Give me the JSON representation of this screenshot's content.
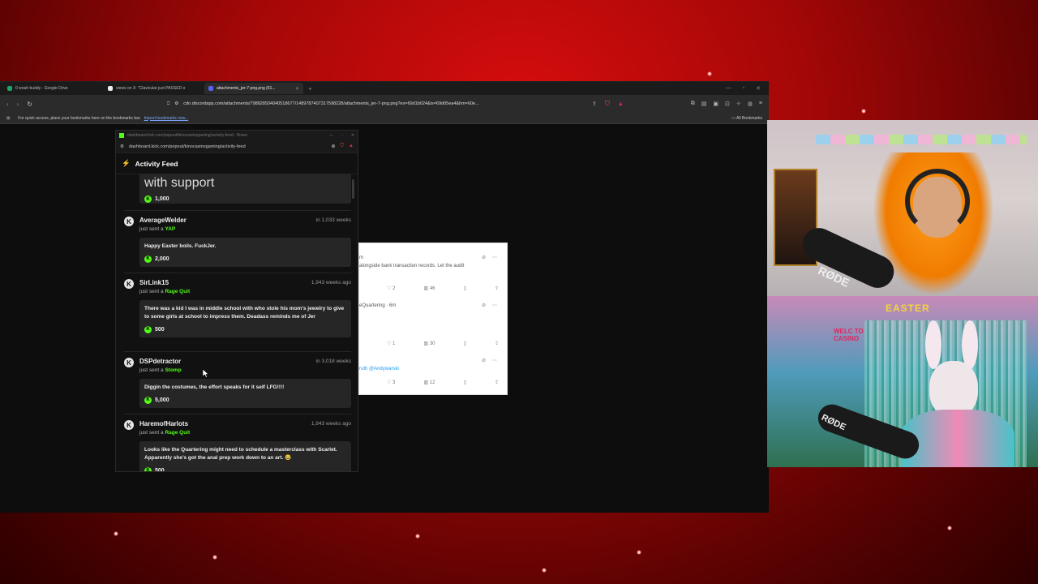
{
  "browser": {
    "tabs": [
      {
        "label": "0 woah buddy - Google Drive",
        "color": "#1fa463"
      },
      {
        "label": "views on X: \"Clavicular just PASSED o",
        "color": "#eeeeee"
      },
      {
        "label": "attachments_jer-7-png.png (61...",
        "color": "#5865f2"
      }
    ],
    "url": "cdn.discordapp.com/attachments/798828934040518677/1489787407317598228/attachments_jer-7-png.png?ex=69d1b024&is=69d05ea4&hm=60e...",
    "bookmarks_prompt": "For quick access, place your bookmarks here on the bookmarks bar.",
    "import_link": "Import bookmarks now...",
    "all_bookmarks": "All Bookmarks"
  },
  "popout": {
    "title_url": "dashboard.kick.com/popout/kinocasinogaming/activity-feed - Brave",
    "url": "dashboard.kick.com/popout/kinocasinogaming/activity-feed",
    "header": "Activity Feed",
    "top_entry": {
      "message": "with support",
      "amount": "1,000"
    },
    "entries": [
      {
        "user": "AverageWelder",
        "time": "in 1,033 weeks",
        "action": "just sent a",
        "item": "YAP",
        "message": "Happy Easter boils. FuckJer.",
        "amount": "2,000"
      },
      {
        "user": "SirLink15",
        "time": "1,943 weeks ago",
        "action": "just sent a",
        "item": "Rage Quit",
        "message": "There was a kid I was in middle school with who stole his mom's jewelry to give to some girls at school to impress them. Deadass reminds me of Jer",
        "amount": "500"
      },
      {
        "user": "DSPdetractor",
        "time": "in 3,018 weeks",
        "action": "just sent a",
        "item": "Stomp",
        "message": "Diggin the costumes, the effort speaks for it self LFG!!!!",
        "amount": "5,000"
      },
      {
        "user": "HaremofHarlots",
        "time": "1,943 weeks ago",
        "action": "just sent a",
        "item": "Rage Quit",
        "message": "Looks like the Quartering might need to schedule a masterclass with Scarlet. Apparently she's got the anal prep work down to an art. 😂",
        "amount": "500"
      }
    ]
  },
  "tweet": {
    "line1_prefix": "m",
    "line2": "alongside bank transaction records. Let the audit",
    "row1": {
      "likes": "2",
      "views": "46"
    },
    "line3": "eQuartering · 6m",
    "row2": {
      "likes": "1",
      "views": "30"
    },
    "line4": "ruth @Andywarski",
    "row3": {
      "likes": "3",
      "views": "12"
    }
  },
  "overlay": {
    "banner": "EASTER",
    "mic1": "RØDE",
    "mic2": "RØDE",
    "sign": "WELC TO CASINO"
  }
}
